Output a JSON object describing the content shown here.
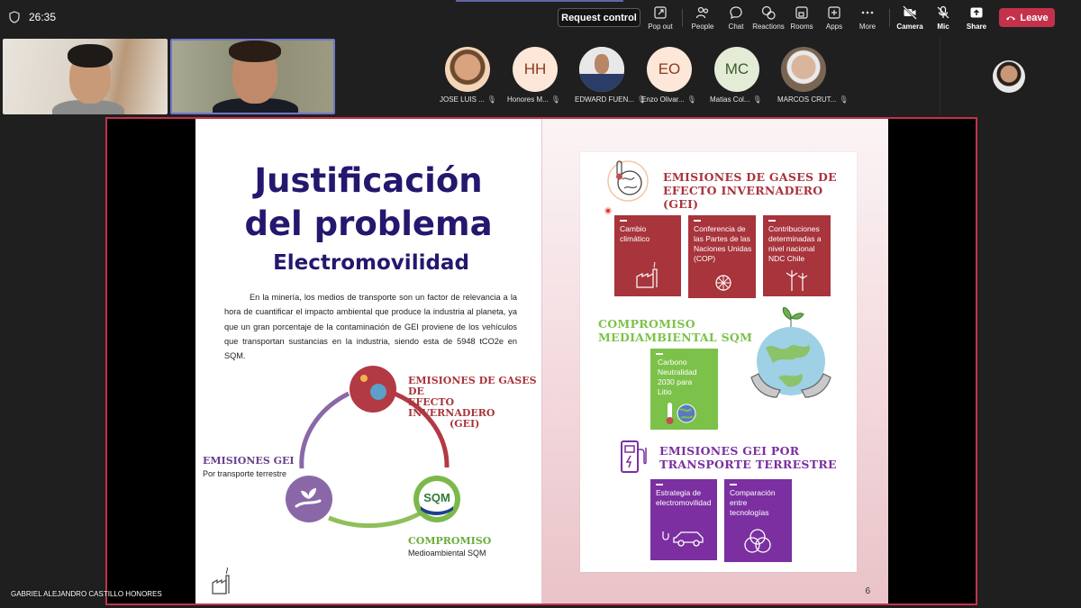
{
  "toolbar": {
    "timer": "26:35",
    "request_control": "Request control",
    "items": [
      {
        "label": "Pop out",
        "icon": "pop-out-icon"
      },
      {
        "label": "People",
        "icon": "people-icon"
      },
      {
        "label": "Chat",
        "icon": "chat-icon"
      },
      {
        "label": "Reactions",
        "icon": "reactions-icon"
      },
      {
        "label": "Rooms",
        "icon": "rooms-icon"
      },
      {
        "label": "Apps",
        "icon": "apps-icon"
      },
      {
        "label": "More",
        "icon": "more-icon"
      },
      {
        "label": "Camera",
        "icon": "camera-off-icon"
      },
      {
        "label": "Mic",
        "icon": "mic-off-icon"
      },
      {
        "label": "Share",
        "icon": "share-icon"
      }
    ],
    "leave": "Leave",
    "accent": "#c4314b"
  },
  "participants": [
    {
      "initials": "",
      "name": "JOSE LUIS ...",
      "bg": "#f4d5b8"
    },
    {
      "initials": "HH",
      "name": "Honores M...",
      "bg": "#fde7d8"
    },
    {
      "initials": "",
      "name": "EDWARD FUEN...",
      "bg": "#e8e8e8"
    },
    {
      "initials": "EO",
      "name": "Enzo Olivar...",
      "bg": "#fde7d8"
    },
    {
      "initials": "MC",
      "name": "Matias Col...",
      "bg": "#e4ecd8"
    },
    {
      "initials": "",
      "name": "MARCOS CRUT...",
      "bg": "#c9b9a6"
    }
  ],
  "presenter_name": "GABRIEL ALEJANDRO CASTILLO HONORES",
  "slide": {
    "title_line1": "Justificación",
    "title_line2": "del problema",
    "subtitle": "Electromovilidad",
    "paragraph": "En la minería, los medios de transporte son un factor de relevancia a la hora de cuantificar el impacto ambiental que produce la industria al planeta, ya que un gran porcentaje de la contaminación de GEI proviene de los vehículos que transportan sustancias en la industria, siendo esta de 5948 tCO2e en SQM.",
    "cycle": {
      "top_label_l1": "EMISIONES DE GASES DE",
      "top_label_l2": "EFECTO INVERNADERO",
      "top_label_l3": "(GEI)",
      "left_label": "EMISIONES GEI",
      "left_sub": "Por transporte terrestre",
      "right_label": "COMPROMISO",
      "right_sub": "Medioambiental SQM",
      "sqm_logo": "SQM"
    },
    "page_number": "6",
    "right": {
      "gei_heading_l1": "EMISIONES DE GASES DE",
      "gei_heading_l2": "EFECTO INVERNADERO (GEI)",
      "gei_boxes": [
        "Cambio climático",
        "Conferencia de las Partes de las Naciones Unidas (COP)",
        "Contribuciones determinadas a nivel nacional NDC Chile"
      ],
      "sqm_heading_l1": "COMPROMISO",
      "sqm_heading_l2": "MEDIAMBIENTAL SQM",
      "sqm_box": "Carbono Neutralidad 2030 para Litio",
      "transport_heading_l1": "EMISIONES GEI POR",
      "transport_heading_l2": "TRANSPORTE TERRESTRE",
      "transport_boxes": [
        "Estrategia de electromovilidad",
        "Comparación entre tecnologías"
      ]
    },
    "colors": {
      "title": "#23186e",
      "gei_red": "#a8343c",
      "sqm_green": "#7cc24a",
      "transport_purple": "#7b2fa0"
    }
  }
}
